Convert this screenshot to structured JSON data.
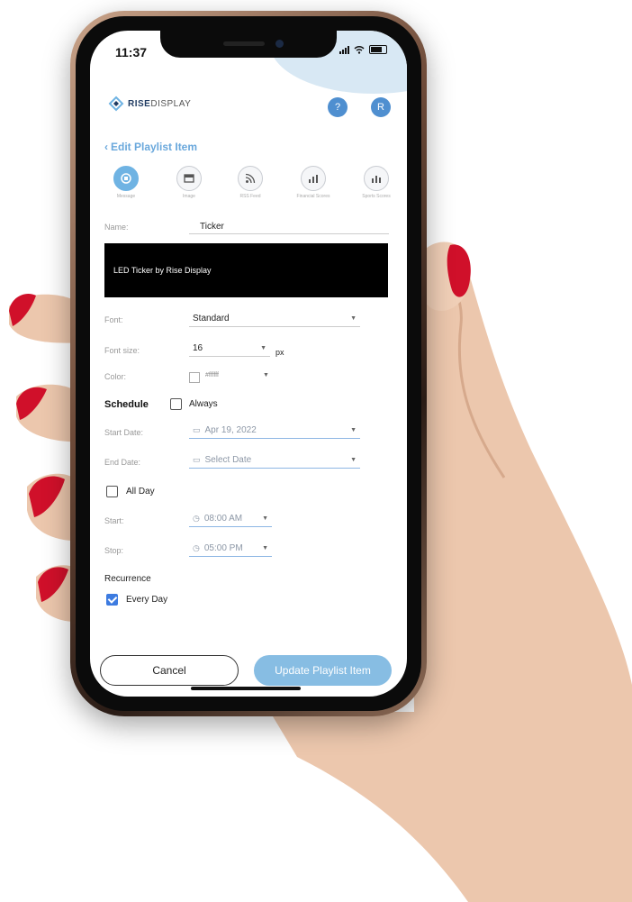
{
  "status_bar": {
    "time": "11:37"
  },
  "header": {
    "logo_bold": "RISE",
    "logo_light": "DISPLAY",
    "help_label": "?",
    "avatar_initial": "R"
  },
  "nav": {
    "back_label": "Edit Playlist Item"
  },
  "item_types": [
    {
      "label": "Message",
      "icon": "message-icon",
      "active": true
    },
    {
      "label": "Image",
      "icon": "image-icon",
      "active": false
    },
    {
      "label": "RSS Feed",
      "icon": "rss-icon",
      "active": false
    },
    {
      "label": "Financial Scores",
      "icon": "chart-icon",
      "active": false
    },
    {
      "label": "Sports Scores",
      "icon": "chart-icon",
      "active": false
    }
  ],
  "form": {
    "name_label": "Name:",
    "name_value": "Ticker",
    "preview_text": "LED Ticker by Rise Display",
    "font_label": "Font:",
    "font_value": "Standard",
    "font_size_label": "Font size:",
    "font_size_value": "16",
    "font_size_unit": "px",
    "color_label": "Color:",
    "color_value": "#ffffff"
  },
  "schedule": {
    "title": "Schedule",
    "always_label": "Always",
    "always_checked": false,
    "start_date_label": "Start Date:",
    "start_date_value": "Apr 19, 2022",
    "end_date_label": "End Date:",
    "end_date_placeholder": "Select Date",
    "all_day_label": "All Day",
    "all_day_checked": false,
    "start_label": "Start:",
    "start_value": "08:00 AM",
    "stop_label": "Stop:",
    "stop_value": "05:00 PM"
  },
  "recurrence": {
    "title": "Recurrence",
    "every_day_label": "Every Day",
    "every_day_checked": true
  },
  "actions": {
    "cancel_label": "Cancel",
    "update_label": "Update Playlist Item"
  },
  "colors": {
    "accent": "#4f8fd0",
    "primary_button": "#87bde3",
    "checkbox_checked": "#3d7be0",
    "preview_bg": "#000000",
    "nail_polish": "#d0102a"
  }
}
